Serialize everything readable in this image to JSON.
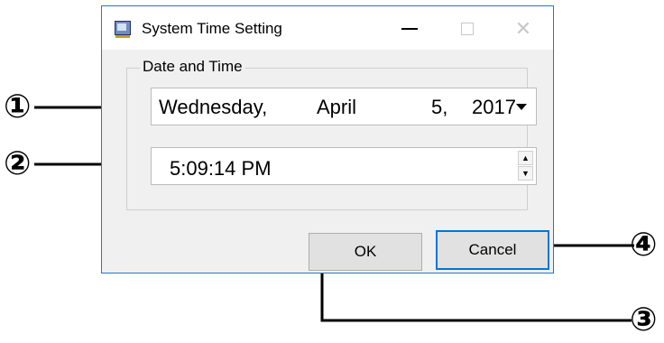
{
  "window": {
    "title": "System Time Setting",
    "controls": {
      "minimize": "—",
      "maximize": "☐",
      "close": "✕"
    }
  },
  "group": {
    "label": "Date and Time"
  },
  "date": {
    "weekday": "Wednesday,",
    "month": "April",
    "day": "5,",
    "year": "2017"
  },
  "time": {
    "value": "5:09:14 PM"
  },
  "buttons": {
    "ok": "OK",
    "cancel": "Cancel"
  },
  "annotations": [
    "①",
    "②",
    "③",
    "④"
  ],
  "icons": [
    "app-icon",
    "dropdown-arrow-icon",
    "spin-up-icon",
    "spin-down-icon"
  ],
  "colors": {
    "accent": "#0078d7",
    "window_border": "#1f78d1",
    "dialog_background": "#f0f0f0"
  }
}
